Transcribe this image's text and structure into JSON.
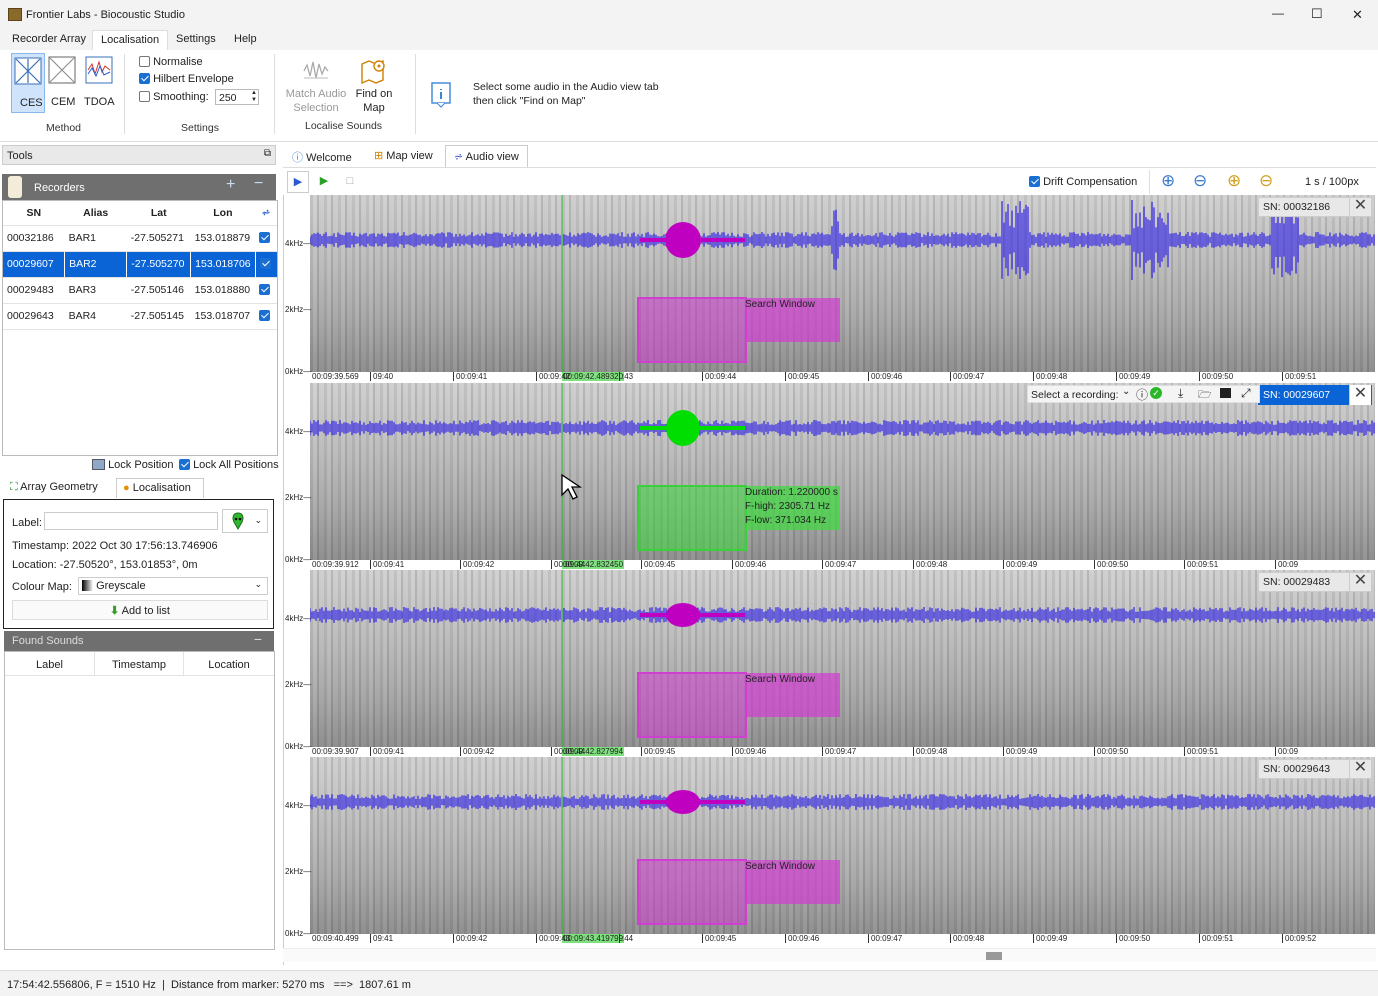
{
  "window": {
    "title": "Frontier Labs - Biocoustic Studio",
    "minimize": "—",
    "maximize": "☐",
    "close": "✕"
  },
  "menu": {
    "items": [
      "Recorder Array",
      "Localisation",
      "Settings",
      "Help"
    ],
    "active": "Localisation"
  },
  "ribbon": {
    "method": {
      "label": "Method",
      "buttons": [
        "CES",
        "CEM",
        "TDOA"
      ],
      "selected": "CES"
    },
    "settings": {
      "label": "Settings",
      "normalise": "Normalise",
      "normalise_checked": false,
      "hilbert": "Hilbert Envelope",
      "hilbert_checked": true,
      "smoothing": "Smoothing:",
      "smoothing_checked": false,
      "smoothing_value": "250"
    },
    "localise": {
      "label": "Localise Sounds",
      "match_audio": "Match Audio Selection",
      "find_on_map": "Find on Map"
    },
    "hint": "Select some audio in the Audio view tab then click \"Find on Map\""
  },
  "tools": {
    "title": "Tools",
    "recorders": {
      "title": "Recorders",
      "columns": [
        "SN",
        "Alias",
        "Lat",
        "Lon"
      ],
      "rows": [
        {
          "sn": "00032186",
          "alias": "BAR1",
          "lat": "-27.505271",
          "lon": "153.018879",
          "checked": true,
          "selected": false
        },
        {
          "sn": "00029607",
          "alias": "BAR2",
          "lat": "-27.505270",
          "lon": "153.018706",
          "checked": true,
          "selected": true
        },
        {
          "sn": "00029483",
          "alias": "BAR3",
          "lat": "-27.505146",
          "lon": "153.018880",
          "checked": true,
          "selected": false
        },
        {
          "sn": "00029643",
          "alias": "BAR4",
          "lat": "-27.505145",
          "lon": "153.018707",
          "checked": true,
          "selected": false
        }
      ]
    },
    "lock_position": "Lock Position",
    "lock_all": "Lock All Positions",
    "lock_all_checked": true,
    "tabs": [
      "Array Geometry",
      "Localisation"
    ],
    "active_tab": "Localisation",
    "form": {
      "label": "Label:",
      "label_value": "",
      "timestamp": "Timestamp:  2022 Oct 30 17:56:13.746906",
      "location": "Location:  -27.50520°, 153.01853°, 0m",
      "colour_map": "Colour Map:",
      "colour_map_value": "Greyscale",
      "add_to_list": "Add to list"
    },
    "found_sounds": {
      "title": "Found Sounds",
      "columns": [
        "Label",
        "Timestamp",
        "Location"
      ]
    }
  },
  "view_tabs": {
    "items": [
      "Welcome",
      "Map view",
      "Audio view"
    ],
    "active": "Audio view"
  },
  "audio_toolbar": {
    "drift": "Drift Compensation",
    "drift_checked": true,
    "scale": "1 s / 100px"
  },
  "tracks": [
    {
      "sn": "SN: 00032186",
      "color": "#2d1fe8",
      "blob": "#c000c0",
      "box_label": "Search Window",
      "marker_time": "00:09:42.489320",
      "start": "00:09:39.569",
      "ticks": [
        "09:40",
        "00:09:41",
        "00:09:42",
        ":43",
        "00:09:44",
        "00:09:45",
        "00:09:46",
        "00:09:47",
        "00:09:48",
        "00:09:49",
        "00:09:50",
        "00:09:51"
      ]
    },
    {
      "sn": "SN: 00029607",
      "color": "#2d1fe8",
      "blob": "#00dd00",
      "box_label": "Duration: 1.220000 s",
      "box_label2": "F-high: 2305.71 Hz",
      "box_label3": "F-low: 371.034 Hz",
      "marker_time": "00:09:42.832450",
      "start": "00:09:39.912",
      "ticks": [
        "00:09:41",
        "00:09:42",
        "00:09:44",
        "00:09:45",
        "00:09:46",
        "00:09:47",
        "00:09:48",
        "00:09:49",
        "00:09:50",
        "00:09:51",
        "00:09"
      ],
      "select_recording": "Select a recording:"
    },
    {
      "sn": "SN: 00029483",
      "color": "#2d1fe8",
      "blob": "#c000c0",
      "box_label": "Search Window",
      "marker_time": "00:09:42.827994",
      "start": "00:09:39.907",
      "ticks": [
        "00:09:41",
        "00:09:42",
        "00:09:44",
        "00:09:45",
        "00:09:46",
        "00:09:47",
        "00:09:48",
        "00:09:49",
        "00:09:50",
        "00:09:51",
        "00:09"
      ]
    },
    {
      "sn": "SN: 00029643",
      "color": "#2d1fe8",
      "blob": "#c000c0",
      "box_label": "Search Window",
      "marker_time": "00:09:43.419799",
      "start": "00:09:40.499",
      "ticks": [
        "09:41",
        "00:09:42",
        "00:09:43",
        ":44",
        "00:09:45",
        "00:09:46",
        "00:09:47",
        "00:09:48",
        "00:09:49",
        "00:09:50",
        "00:09:51",
        "00:09:52"
      ]
    }
  ],
  "freq_labels": [
    "4kHz",
    "2kHz",
    "0kHz"
  ],
  "status": "17:54:42.556806, F = 1510 Hz  |  Distance from marker: 5270 ms   ==>  1807.61 m"
}
